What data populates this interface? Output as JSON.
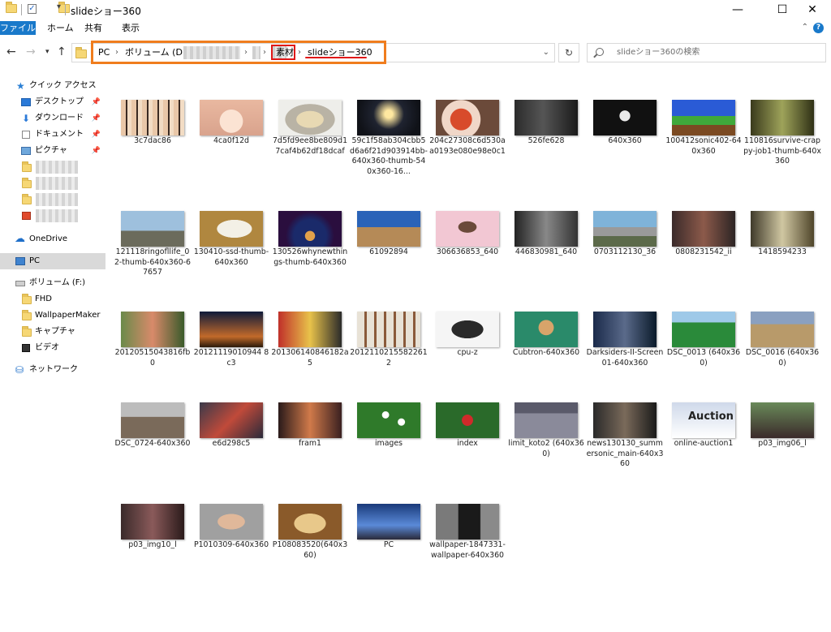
{
  "window": {
    "title": "slideショー360",
    "controls": {
      "minimize": "—",
      "maximize": "☐",
      "close": "✕"
    }
  },
  "ribbon": {
    "tabs": [
      "ファイル",
      "ホーム",
      "共有",
      "表示"
    ],
    "help": "?"
  },
  "address": {
    "crumbs": [
      "PC",
      "ボリューム (D:)",
      "素材",
      "slideショー360"
    ],
    "search_placeholder": "slideショー360の検索"
  },
  "nav": {
    "quick_access": "クイック アクセス",
    "items": [
      {
        "label": "デスクトップ",
        "icon": "desktop-icon",
        "pinned": true
      },
      {
        "label": "ダウンロード",
        "icon": "download-icon",
        "pinned": true
      },
      {
        "label": "ドキュメント",
        "icon": "document-icon",
        "pinned": true
      },
      {
        "label": "ピクチャ",
        "icon": "pictures-icon",
        "pinned": true
      }
    ],
    "onedrive": "OneDrive",
    "pc": "PC",
    "volume_f": "ボリューム (F:)",
    "f_items": [
      "FHD",
      "WallpaperMaker",
      "キャプチャ",
      "ビデオ"
    ],
    "network": "ネットワーク"
  },
  "files": [
    {
      "name": "3c7dac86"
    },
    {
      "name": "4ca0f12d"
    },
    {
      "name": "7d5fd9ee8be809d17caf4b62df18dcaf"
    },
    {
      "name": "59c1f58ab304cbb5d6a6f21d903914bb-640x360-thumb-540x360-16..."
    },
    {
      "name": "204c27308c6d530aa0193e080e98e0c1"
    },
    {
      "name": "526fe628"
    },
    {
      "name": "640x360"
    },
    {
      "name": "100412sonic402-640x360"
    },
    {
      "name": "110816survive-crappy-job1-thumb-640x360"
    },
    {
      "name": "121118ringofllife_02-thumb-640x360-67657"
    },
    {
      "name": "130410-ssd-thumb-640x360"
    },
    {
      "name": "130526whynewthings-thumb-640x360"
    },
    {
      "name": "61092894"
    },
    {
      "name": "306636853_640"
    },
    {
      "name": "446830981_640"
    },
    {
      "name": "0703112130_36"
    },
    {
      "name": "0808231542_ii"
    },
    {
      "name": "1418594233"
    },
    {
      "name": "20120515043816fb0"
    },
    {
      "name": "20121119010944 8c3"
    },
    {
      "name": "201306140846182a5"
    },
    {
      "name": "20121102155822612"
    },
    {
      "name": "cpu-z"
    },
    {
      "name": "Cubtron-640x360"
    },
    {
      "name": "Darksiders-II-Screen01-640x360"
    },
    {
      "name": "DSC_0013 (640x360)"
    },
    {
      "name": "DSC_0016 (640x360)"
    },
    {
      "name": "DSC_0724-640x360"
    },
    {
      "name": "e6d298c5"
    },
    {
      "name": "fram1"
    },
    {
      "name": "images"
    },
    {
      "name": "index"
    },
    {
      "name": "limit_koto2 (640x360)"
    },
    {
      "name": "news130130_summersonic_main-640x360"
    },
    {
      "name": "online-auction1"
    },
    {
      "name": "p03_img06_l"
    },
    {
      "name": "p03_img10_l"
    },
    {
      "name": "P1010309-640x360"
    },
    {
      "name": "P108083520(640x360)"
    },
    {
      "name": "PC"
    },
    {
      "name": "wallpaper-1847331-wallpaper-640x360"
    }
  ],
  "annotation_text": "Auction"
}
